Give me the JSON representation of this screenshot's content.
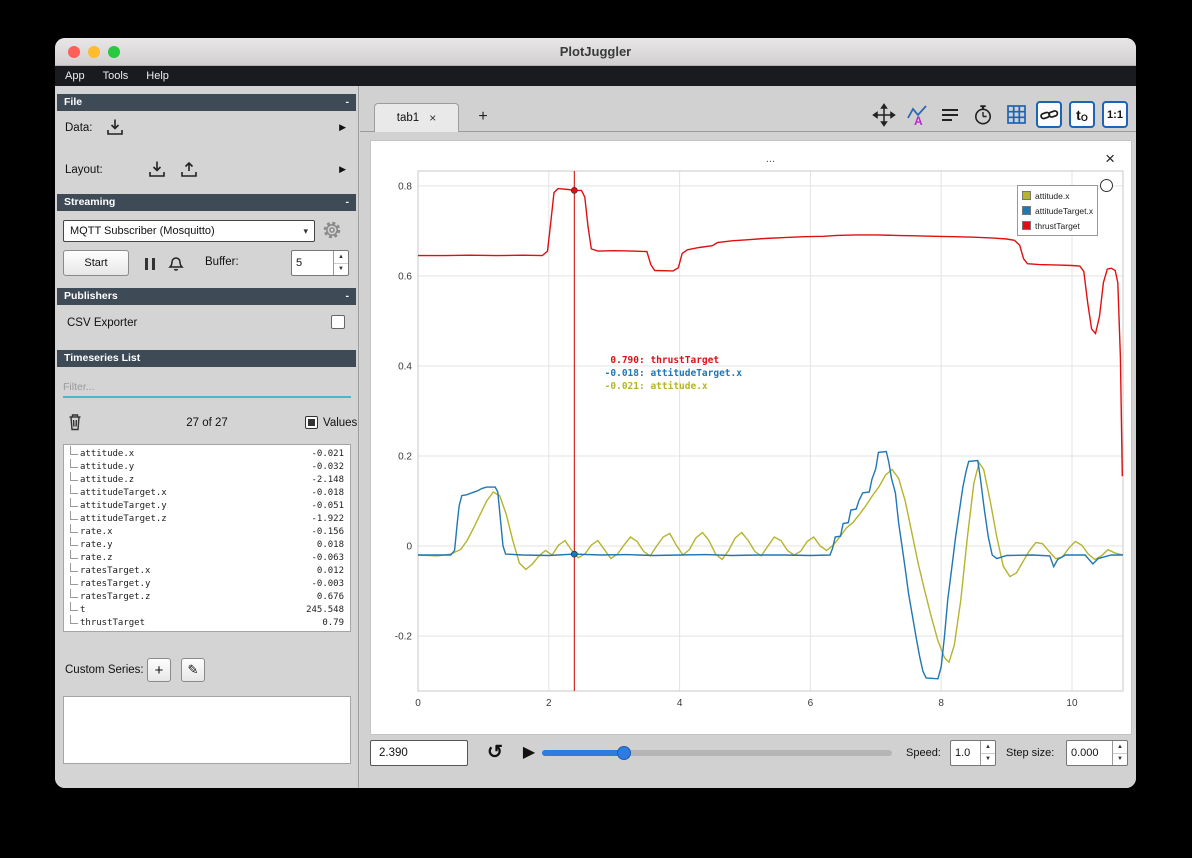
{
  "window": {
    "title": "PlotJuggler"
  },
  "menu": {
    "items": [
      "App",
      "Tools",
      "Help"
    ]
  },
  "glyphs": {
    "close": "×",
    "add": "+",
    "play": "▶",
    "loop": "↺",
    "up": "▲",
    "down": "▼",
    "expand": "▶",
    "pencil": "✎",
    "chevron": "▾",
    "collapse": "-"
  },
  "sidebar": {
    "file": {
      "title": "File",
      "data_label": "Data:",
      "layout_label": "Layout:"
    },
    "streaming": {
      "title": "Streaming",
      "source_selected": "MQTT Subscriber (Mosquitto)",
      "start_label": "Start",
      "buffer_label": "Buffer:",
      "buffer_value": "5"
    },
    "publishers": {
      "title": "Publishers",
      "csv_label": "CSV Exporter"
    },
    "timeseries": {
      "title": "Timeseries List",
      "filter_placeholder": "Filter...",
      "count": "27 of 27",
      "values_label": "Values",
      "items": [
        {
          "name": "attitude.x",
          "value": "-0.021"
        },
        {
          "name": "attitude.y",
          "value": "-0.032"
        },
        {
          "name": "attitude.z",
          "value": "-2.148"
        },
        {
          "name": "attitudeTarget.x",
          "value": "-0.018"
        },
        {
          "name": "attitudeTarget.y",
          "value": "-0.051"
        },
        {
          "name": "attitudeTarget.z",
          "value": "-1.922"
        },
        {
          "name": "rate.x",
          "value": "-0.156"
        },
        {
          "name": "rate.y",
          "value": "0.018"
        },
        {
          "name": "rate.z",
          "value": "-0.063"
        },
        {
          "name": "ratesTarget.x",
          "value": "0.012"
        },
        {
          "name": "ratesTarget.y",
          "value": "-0.003"
        },
        {
          "name": "ratesTarget.z",
          "value": "0.676"
        },
        {
          "name": "t",
          "value": "245.548"
        },
        {
          "name": "thrustTarget",
          "value": "0.79"
        }
      ],
      "custom_series_label": "Custom Series:"
    }
  },
  "main": {
    "tab_label": "tab1",
    "toolbar": {
      "t0_main": "t",
      "t0_sub": "O",
      "ratio": "1:1"
    },
    "playback": {
      "time": "2.390",
      "speed_label": "Speed:",
      "speed_value": "1.0",
      "step_label": "Step size:",
      "step_value": "0.000"
    }
  },
  "chart_data": {
    "type": "line",
    "title": "...",
    "xlim": [
      0,
      10.78
    ],
    "ylim": [
      -0.322,
      0.833
    ],
    "xticks": [
      0,
      2,
      4,
      6,
      8,
      10
    ],
    "xtick_labels": [
      "0",
      "2",
      "4",
      "6",
      "8",
      "10"
    ],
    "yticks": [
      -0.2,
      0,
      0.2,
      0.4,
      0.6,
      0.8
    ],
    "ytick_labels": [
      "-0.2",
      "0",
      "0.2",
      "0.4",
      "0.6",
      "0.8"
    ],
    "grid": true,
    "legend_position": "top-right",
    "tracker": {
      "x": 2.39,
      "color": "#cc0000",
      "dots": [
        {
          "series": "thrustTarget",
          "y": 0.79
        },
        {
          "series": "attitudeTarget.x",
          "y": -0.018
        }
      ],
      "readings": [
        {
          "value": "0.790",
          "series": "thrustTarget"
        },
        {
          "value": "-0.018",
          "series": "attitudeTarget.x"
        },
        {
          "value": "-0.021",
          "series": "attitude.x"
        }
      ]
    },
    "series": [
      {
        "name": "attitude.x",
        "color": "#b5b42c",
        "points": [
          [
            0,
            -0.02
          ],
          [
            0.3,
            -0.022
          ],
          [
            0.5,
            -0.018
          ],
          [
            0.65,
            -0.008
          ],
          [
            0.75,
            0.012
          ],
          [
            0.85,
            0.04
          ],
          [
            0.95,
            0.07
          ],
          [
            1.05,
            0.1
          ],
          [
            1.15,
            0.12
          ],
          [
            1.25,
            0.112
          ],
          [
            1.35,
            0.07
          ],
          [
            1.45,
            0.012
          ],
          [
            1.55,
            -0.038
          ],
          [
            1.65,
            -0.052
          ],
          [
            1.75,
            -0.04
          ],
          [
            1.85,
            -0.022
          ],
          [
            1.95,
            -0.01
          ],
          [
            2.05,
            -0.02
          ],
          [
            2.15,
            0.002
          ],
          [
            2.25,
            0.012
          ],
          [
            2.35,
            -0.01
          ],
          [
            2.45,
            -0.026
          ],
          [
            2.55,
            -0.018
          ],
          [
            2.65,
            0.002
          ],
          [
            2.75,
            0.012
          ],
          [
            2.85,
            -0.008
          ],
          [
            2.95,
            -0.028
          ],
          [
            3.05,
            -0.018
          ],
          [
            3.15,
            0.002
          ],
          [
            3.25,
            0.02
          ],
          [
            3.35,
            0.01
          ],
          [
            3.45,
            -0.012
          ],
          [
            3.55,
            -0.022
          ],
          [
            3.65,
            0
          ],
          [
            3.75,
            0.02
          ],
          [
            3.85,
            0.028
          ],
          [
            3.95,
            0.002
          ],
          [
            4.05,
            -0.02
          ],
          [
            4.15,
            -0.008
          ],
          [
            4.25,
            0.018
          ],
          [
            4.35,
            0.03
          ],
          [
            4.45,
            0.012
          ],
          [
            4.55,
            -0.018
          ],
          [
            4.65,
            -0.03
          ],
          [
            4.75,
            -0.01
          ],
          [
            4.85,
            0.018
          ],
          [
            4.95,
            0.03
          ],
          [
            5.05,
            0.012
          ],
          [
            5.15,
            -0.012
          ],
          [
            5.25,
            -0.022
          ],
          [
            5.35,
            0
          ],
          [
            5.45,
            0.02
          ],
          [
            5.55,
            0.012
          ],
          [
            5.65,
            -0.01
          ],
          [
            5.75,
            -0.02
          ],
          [
            5.85,
            -0.012
          ],
          [
            5.95,
            0.01
          ],
          [
            6.05,
            0.02
          ],
          [
            6.15,
            0
          ],
          [
            6.25,
            -0.01
          ],
          [
            6.35,
            0.002
          ],
          [
            6.45,
            0.02
          ],
          [
            6.55,
            0.04
          ],
          [
            6.65,
            0.052
          ],
          [
            6.75,
            0.07
          ],
          [
            6.85,
            0.09
          ],
          [
            6.95,
            0.112
          ],
          [
            7.05,
            0.132
          ],
          [
            7.15,
            0.158
          ],
          [
            7.25,
            0.17
          ],
          [
            7.35,
            0.15
          ],
          [
            7.45,
            0.1
          ],
          [
            7.55,
            0.03
          ],
          [
            7.65,
            -0.04
          ],
          [
            7.75,
            -0.1
          ],
          [
            7.85,
            -0.158
          ],
          [
            7.95,
            -0.21
          ],
          [
            8.05,
            -0.248
          ],
          [
            8.12,
            -0.258
          ],
          [
            8.2,
            -0.22
          ],
          [
            8.3,
            -0.12
          ],
          [
            8.4,
            0.02
          ],
          [
            8.5,
            0.14
          ],
          [
            8.58,
            0.185
          ],
          [
            8.65,
            0.17
          ],
          [
            8.75,
            0.1
          ],
          [
            8.85,
            0.02
          ],
          [
            8.95,
            -0.045
          ],
          [
            9.05,
            -0.068
          ],
          [
            9.15,
            -0.06
          ],
          [
            9.25,
            -0.035
          ],
          [
            9.35,
            -0.01
          ],
          [
            9.45,
            0.008
          ],
          [
            9.55,
            0.005
          ],
          [
            9.65,
            -0.012
          ],
          [
            9.75,
            -0.028
          ],
          [
            9.85,
            -0.025
          ],
          [
            9.95,
            -0.005
          ],
          [
            10.05,
            0.01
          ],
          [
            10.15,
            0.002
          ],
          [
            10.25,
            -0.018
          ],
          [
            10.35,
            -0.03
          ],
          [
            10.45,
            -0.022
          ],
          [
            10.55,
            -0.008
          ],
          [
            10.65,
            -0.015
          ],
          [
            10.78,
            -0.02
          ]
        ]
      },
      {
        "name": "attitudeTarget.x",
        "color": "#1f77b4",
        "points": [
          [
            0,
            -0.02
          ],
          [
            0.5,
            -0.02
          ],
          [
            0.56,
            -0.01
          ],
          [
            0.6,
            0.05
          ],
          [
            0.63,
            0.09
          ],
          [
            0.67,
            0.112
          ],
          [
            0.75,
            0.114
          ],
          [
            0.82,
            0.118
          ],
          [
            0.9,
            0.122
          ],
          [
            0.98,
            0.128
          ],
          [
            1.05,
            0.131
          ],
          [
            1.18,
            0.131
          ],
          [
            1.22,
            0.12
          ],
          [
            1.26,
            0.06
          ],
          [
            1.3,
            0
          ],
          [
            1.34,
            -0.018
          ],
          [
            1.6,
            -0.02
          ],
          [
            2,
            -0.021
          ],
          [
            2.39,
            -0.018
          ],
          [
            2.8,
            -0.02
          ],
          [
            3.2,
            -0.019
          ],
          [
            3.6,
            -0.021
          ],
          [
            4,
            -0.02
          ],
          [
            4.4,
            -0.019
          ],
          [
            4.8,
            -0.021
          ],
          [
            5.2,
            -0.02
          ],
          [
            5.6,
            -0.02
          ],
          [
            6,
            -0.021
          ],
          [
            6.3,
            -0.02
          ],
          [
            6.34,
            -0.005
          ],
          [
            6.38,
            0.02
          ],
          [
            6.46,
            0.022
          ],
          [
            6.5,
            0.05
          ],
          [
            6.58,
            0.052
          ],
          [
            6.62,
            0.08
          ],
          [
            6.7,
            0.082
          ],
          [
            6.74,
            0.1
          ],
          [
            6.8,
            0.118
          ],
          [
            6.9,
            0.12
          ],
          [
            6.94,
            0.148
          ],
          [
            7,
            0.172
          ],
          [
            7.04,
            0.208
          ],
          [
            7.16,
            0.21
          ],
          [
            7.2,
            0.185
          ],
          [
            7.24,
            0.15
          ],
          [
            7.3,
            0.118
          ],
          [
            7.35,
            0.05
          ],
          [
            7.4,
            0
          ],
          [
            7.45,
            -0.05
          ],
          [
            7.5,
            -0.105
          ],
          [
            7.56,
            -0.155
          ],
          [
            7.62,
            -0.205
          ],
          [
            7.67,
            -0.245
          ],
          [
            7.72,
            -0.278
          ],
          [
            7.77,
            -0.293
          ],
          [
            7.95,
            -0.295
          ],
          [
            8,
            -0.268
          ],
          [
            8.05,
            -0.2
          ],
          [
            8.1,
            -0.12
          ],
          [
            8.16,
            -0.05
          ],
          [
            8.22,
            0.02
          ],
          [
            8.28,
            0.08
          ],
          [
            8.33,
            0.13
          ],
          [
            8.38,
            0.165
          ],
          [
            8.42,
            0.188
          ],
          [
            8.56,
            0.19
          ],
          [
            8.6,
            0.15
          ],
          [
            8.66,
            0.08
          ],
          [
            8.72,
            0.02
          ],
          [
            8.78,
            -0.02
          ],
          [
            8.85,
            -0.028
          ],
          [
            9,
            -0.021
          ],
          [
            9.4,
            -0.02
          ],
          [
            9.66,
            -0.022
          ],
          [
            9.72,
            -0.046
          ],
          [
            9.78,
            -0.03
          ],
          [
            9.9,
            -0.02
          ],
          [
            10.2,
            -0.02
          ],
          [
            10.32,
            -0.04
          ],
          [
            10.4,
            -0.028
          ],
          [
            10.6,
            -0.02
          ],
          [
            10.78,
            -0.02
          ]
        ]
      },
      {
        "name": "thrustTarget",
        "color": "#e01010",
        "points": [
          [
            0,
            0.645
          ],
          [
            0.4,
            0.645
          ],
          [
            0.8,
            0.646
          ],
          [
            1.2,
            0.645
          ],
          [
            1.6,
            0.646
          ],
          [
            1.9,
            0.645
          ],
          [
            1.98,
            0.655
          ],
          [
            2.03,
            0.72
          ],
          [
            2.08,
            0.785
          ],
          [
            2.14,
            0.794
          ],
          [
            2.3,
            0.792
          ],
          [
            2.39,
            0.79
          ],
          [
            2.5,
            0.79
          ],
          [
            2.55,
            0.775
          ],
          [
            2.6,
            0.71
          ],
          [
            2.65,
            0.66
          ],
          [
            2.75,
            0.655
          ],
          [
            3,
            0.656
          ],
          [
            3.3,
            0.655
          ],
          [
            3.5,
            0.654
          ],
          [
            3.56,
            0.625
          ],
          [
            3.62,
            0.612
          ],
          [
            3.9,
            0.611
          ],
          [
            3.98,
            0.618
          ],
          [
            4.04,
            0.65
          ],
          [
            4.12,
            0.658
          ],
          [
            4.3,
            0.663
          ],
          [
            4.5,
            0.667
          ],
          [
            4.58,
            0.674
          ],
          [
            4.8,
            0.678
          ],
          [
            5,
            0.68
          ],
          [
            5.3,
            0.683
          ],
          [
            5.6,
            0.685
          ],
          [
            5.9,
            0.687
          ],
          [
            6.2,
            0.688
          ],
          [
            6.4,
            0.69
          ],
          [
            6.7,
            0.691
          ],
          [
            7,
            0.691
          ],
          [
            7.3,
            0.69
          ],
          [
            7.6,
            0.689
          ],
          [
            7.9,
            0.688
          ],
          [
            8.2,
            0.687
          ],
          [
            8.5,
            0.686
          ],
          [
            8.8,
            0.684
          ],
          [
            9,
            0.682
          ],
          [
            9.12,
            0.679
          ],
          [
            9.2,
            0.668
          ],
          [
            9.26,
            0.638
          ],
          [
            9.32,
            0.627
          ],
          [
            9.5,
            0.625
          ],
          [
            9.8,
            0.624
          ],
          [
            10,
            0.623
          ],
          [
            10.12,
            0.622
          ],
          [
            10.18,
            0.61
          ],
          [
            10.24,
            0.54
          ],
          [
            10.3,
            0.482
          ],
          [
            10.36,
            0.472
          ],
          [
            10.42,
            0.51
          ],
          [
            10.48,
            0.585
          ],
          [
            10.54,
            0.615
          ],
          [
            10.6,
            0.617
          ],
          [
            10.66,
            0.612
          ],
          [
            10.7,
            0.585
          ],
          [
            10.74,
            0.42
          ],
          [
            10.77,
            0.155
          ]
        ]
      }
    ]
  }
}
